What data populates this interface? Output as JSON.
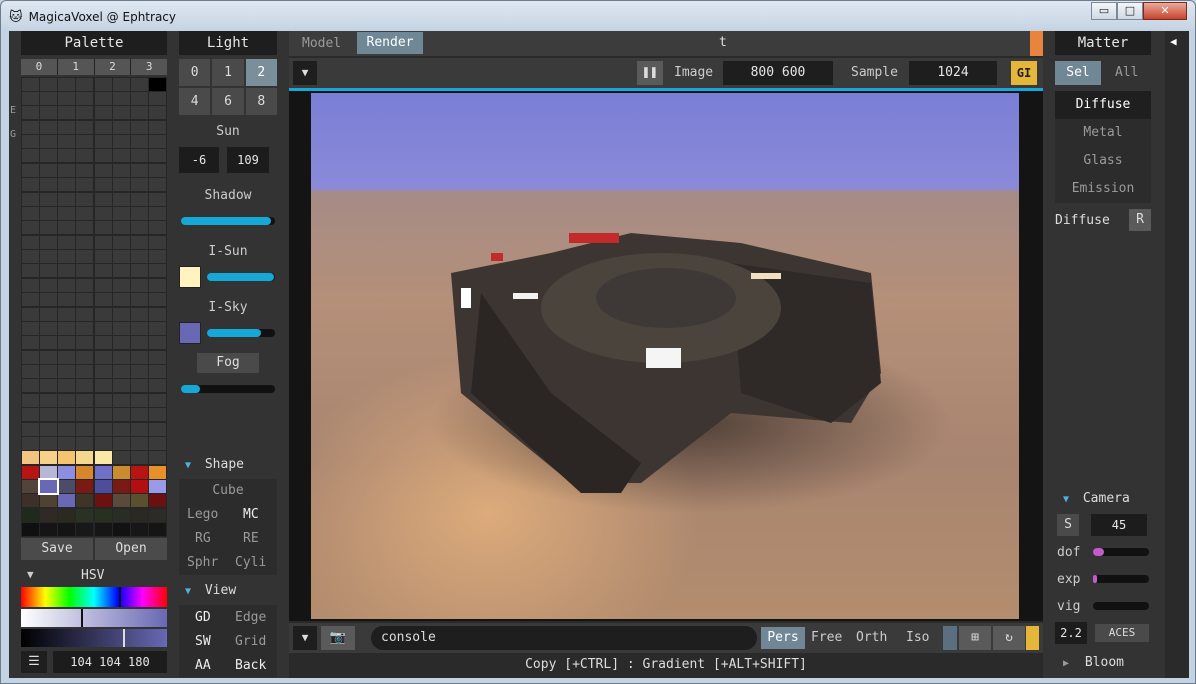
{
  "window": {
    "title": "MagicaVoxel @ Ephtracy",
    "min": "▭",
    "max": "□",
    "close": "✕"
  },
  "palette": {
    "header": "Palette",
    "tabs": [
      "0",
      "1",
      "2",
      "3"
    ],
    "side_labels": [
      "E",
      "G"
    ],
    "save": "Save",
    "open": "Open",
    "hsv_label": "HSV",
    "menu_icon": "☰",
    "rgb": "104 104 180"
  },
  "light": {
    "header": "Light",
    "slots": [
      "0",
      "1",
      "2",
      "4",
      "6",
      "8"
    ],
    "sun_label": "Sun",
    "sun_a": "-6",
    "sun_b": "109",
    "shadow_label": "Shadow",
    "shadow_value": 0.96,
    "isun_label": "I-Sun",
    "isun_value": 0.99,
    "isky_label": "I-Sky",
    "isky_value": 0.8,
    "fog_label": "Fog",
    "fog_value": 0.2,
    "sun_color": "#fff4c0",
    "sky_color": "#6868b4"
  },
  "shape": {
    "label": "Shape",
    "items": [
      [
        "Cube"
      ],
      [
        "Lego",
        "MC"
      ],
      [
        "RG",
        "RE"
      ],
      [
        "Sphr",
        "Cyli"
      ]
    ]
  },
  "view": {
    "label": "View",
    "items": [
      [
        "GD",
        "Edge"
      ],
      [
        "SW",
        "Grid"
      ],
      [
        "AA",
        "Back"
      ]
    ]
  },
  "top": {
    "tab_model": "Model",
    "tab_render": "Render",
    "title": "t",
    "image_label": "Image",
    "image_size": "800 600",
    "sample_label": "Sample",
    "sample_value": "1024",
    "gi": "GI"
  },
  "bottom": {
    "console": "console",
    "modes": [
      "Pers",
      "Free",
      "Orth",
      "Iso"
    ],
    "status": "Copy [+CTRL] : Gradient [+ALT+SHIFT]"
  },
  "matter": {
    "header": "Matter",
    "sel": "Sel",
    "all": "All",
    "materials": [
      "Diffuse",
      "Metal",
      "Glass",
      "Emission"
    ],
    "current": "Diffuse",
    "r_button": "R"
  },
  "camera": {
    "label": "Camera",
    "s_button": "S",
    "fov": "45",
    "dof_label": "dof",
    "dof_value": 0.2,
    "exp_label": "exp",
    "exp_value": 0.07,
    "vig_label": "vig",
    "vig_value": 0,
    "gamma": "2.2",
    "aces": "ACES",
    "bloom": "Bloom"
  },
  "colors": {
    "accent": "#16a8d6",
    "selected": "#7b8f9b",
    "gi": "#e6b63a",
    "orange": "#e8843c"
  }
}
